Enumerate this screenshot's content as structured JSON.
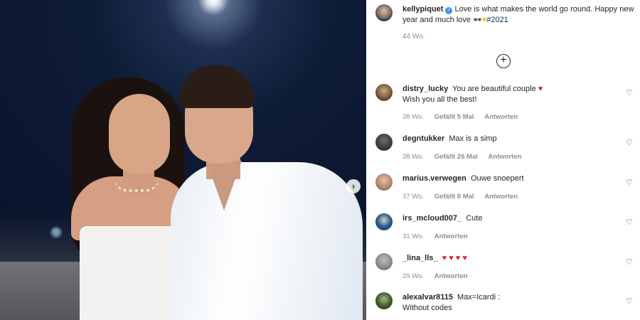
{
  "carousel": {
    "next_icon": "chevron-right-icon",
    "next_glyph": "›"
  },
  "caption": {
    "username": "kellypiquet",
    "text": "Love is what makes the world go round. Happy new year and much love",
    "emoji_1": "🕶",
    "emoji_2": "♥",
    "hashtag": "#2021",
    "time": "44 Wo."
  },
  "load_more": {
    "icon": "plus-circle-icon",
    "glyph": "+"
  },
  "comments": [
    {
      "username": "distry_lucky",
      "text": "You are beautiful couple",
      "emoji": "♥",
      "text_2": "Wish you all the best!",
      "time": "38 Wo.",
      "likes": "Gefällt 5 Mal",
      "reply": "Antworten",
      "avatar_color": "#7a5a3e"
    },
    {
      "username": "degntukker",
      "text": "Max is a simp",
      "time": "38 Wo.",
      "likes": "Gefällt 26 Mal",
      "reply": "Antworten",
      "avatar_color": "#3b3b3b"
    },
    {
      "username": "marius.verwegen",
      "text": "Ouwe snoepert",
      "time": "37 Wo.",
      "likes": "Gefällt 8 Mal",
      "reply": "Antworten",
      "avatar_color": "#b58a6e"
    },
    {
      "username": "irs_mcloud007_",
      "text": "Cute",
      "time": "31 Wo.",
      "reply": "Antworten",
      "avatar_color": "#2a5d8a"
    },
    {
      "username": "_lina_lls_",
      "emoji": "♥ ♥ ♥ ♥",
      "time": "29 Wo.",
      "reply": "Antworten",
      "avatar_color": "#8c8c8c"
    },
    {
      "username": "alexalvar8115",
      "text": "Max=Icardi :",
      "text_2": "Without codes",
      "avatar_color": "#3d5a2a"
    }
  ],
  "like_icon": "♡",
  "colors": {
    "link": "#00376b",
    "secondary": "#8e8e8e",
    "verified": "#3897f0",
    "heart": "#e0242e"
  }
}
